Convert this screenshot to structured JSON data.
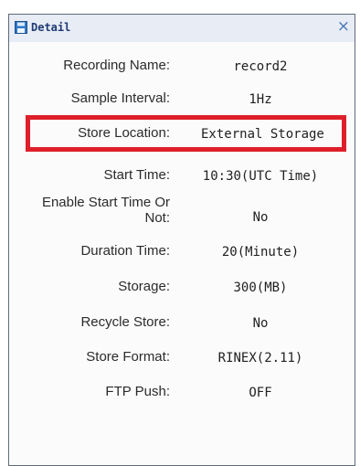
{
  "window": {
    "title": "Detail",
    "close_glyph": "×",
    "icon": "floppy-disk-icon",
    "highlight_color": "#dd1f2a",
    "title_color": "#1f3b73"
  },
  "fields": [
    {
      "label": "Recording Name:",
      "value": "record2"
    },
    {
      "label": "Sample Interval:",
      "value": "1Hz"
    },
    {
      "label": "Store Location:",
      "value": "External Storage"
    },
    {
      "label": "Start Time:",
      "value": "10:30(UTC Time)"
    },
    {
      "label": "Enable Start Time Or Not:",
      "value": "No"
    },
    {
      "label": "Duration Time:",
      "value": "20(Minute)"
    },
    {
      "label": "Storage:",
      "value": "300(MB)"
    },
    {
      "label": "Recycle Store:",
      "value": "No"
    },
    {
      "label": "Store Format:",
      "value": "RINEX(2.11)"
    },
    {
      "label": "FTP Push:",
      "value": "OFF"
    }
  ]
}
